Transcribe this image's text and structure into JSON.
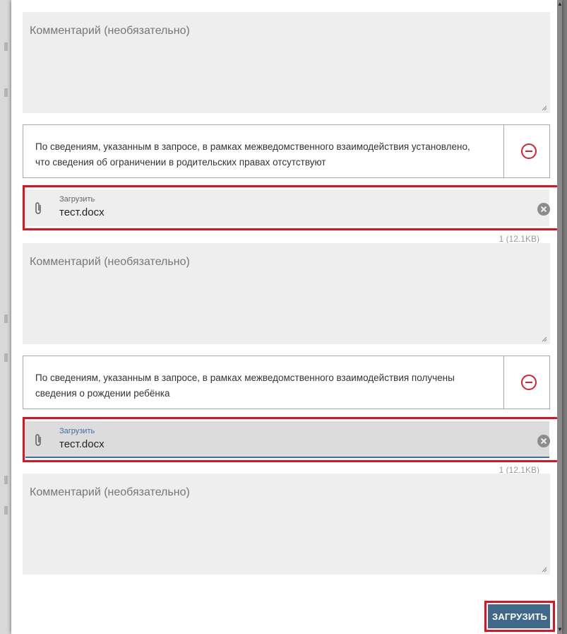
{
  "comment_placeholder": "Комментарий (необязательно)",
  "cards": [
    {
      "text": "По сведениям, указанным в запросе, в рамках межведомственного взаимодействия установлено, что сведения об ограничении в родительских правах отсутствуют",
      "remove_icon": "minus-circle-icon",
      "upload": {
        "label": "Загрузить",
        "file": "тест.docx",
        "size": "1 (12.1KB)"
      }
    },
    {
      "text": "По сведениям, указанным в запросе, в рамках межведомственного взаимодействия получены сведения о рождении ребёнка",
      "remove_icon": "minus-circle-icon",
      "upload": {
        "label": "Загрузить",
        "file": "тест.docx",
        "size": "1 (12.1KB)"
      }
    }
  ],
  "submit_label": "ЗАГРУЗИТЬ",
  "colors": {
    "accent": "#3f6889",
    "highlight": "#e1121d",
    "remove": "#d9232e",
    "focus": "#3e6fa3"
  }
}
